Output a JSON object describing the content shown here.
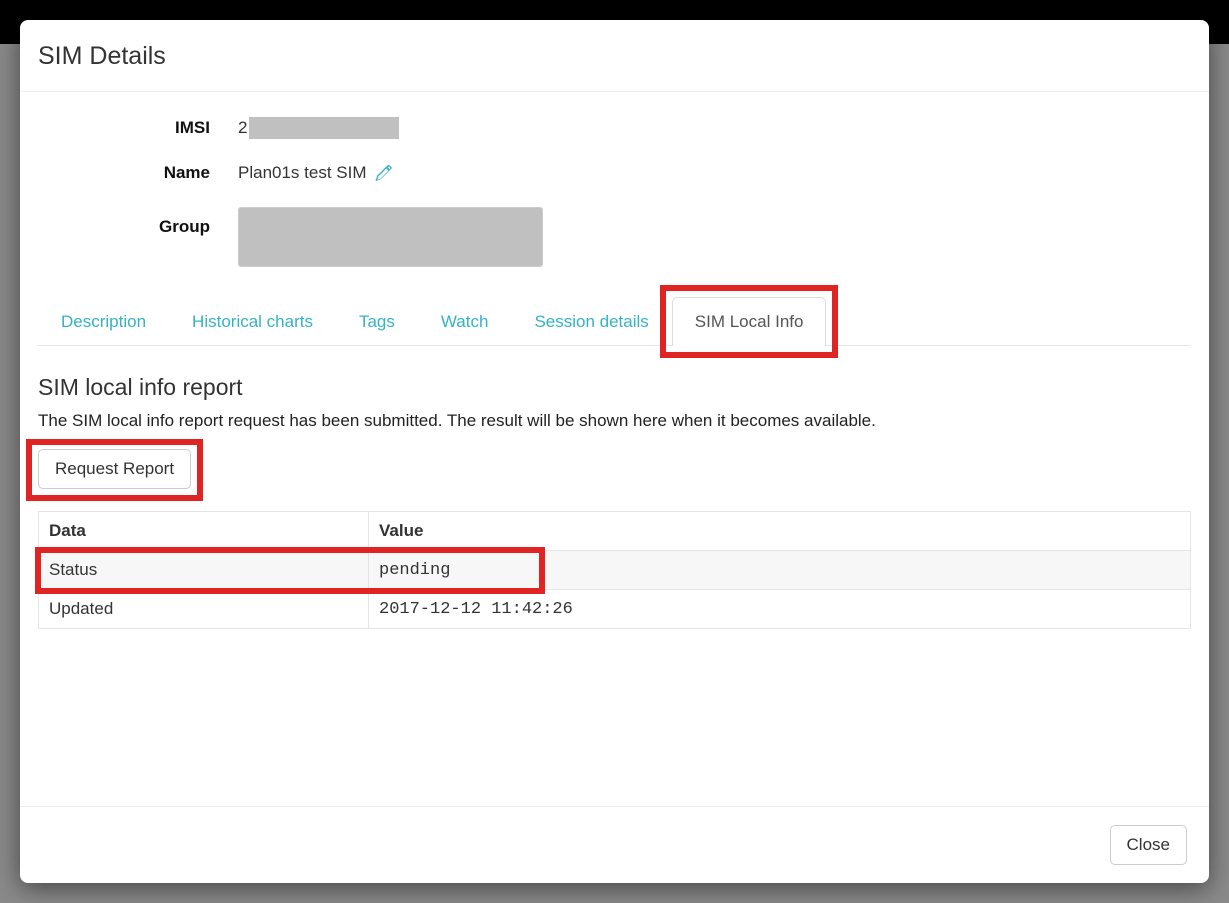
{
  "modal": {
    "title": "SIM Details",
    "close_label": "Close"
  },
  "details": {
    "imsi_label": "IMSI",
    "imsi_value_prefix": "2",
    "name_label": "Name",
    "name_value": "Plan01s test SIM",
    "group_label": "Group"
  },
  "tabs": {
    "description": "Description",
    "historical_charts": "Historical charts",
    "tags": "Tags",
    "watch": "Watch",
    "session_details": "Session details",
    "sim_local_info": "SIM Local Info"
  },
  "local_info": {
    "heading": "SIM local info report",
    "description": "The SIM local info report request has been submitted. The result will be shown here when it becomes available.",
    "request_button": "Request Report",
    "table": {
      "col_data": "Data",
      "col_value": "Value",
      "rows": [
        {
          "label": "Status",
          "value": "pending"
        },
        {
          "label": "Updated",
          "value": "2017-12-12 11:42:26"
        }
      ]
    }
  }
}
